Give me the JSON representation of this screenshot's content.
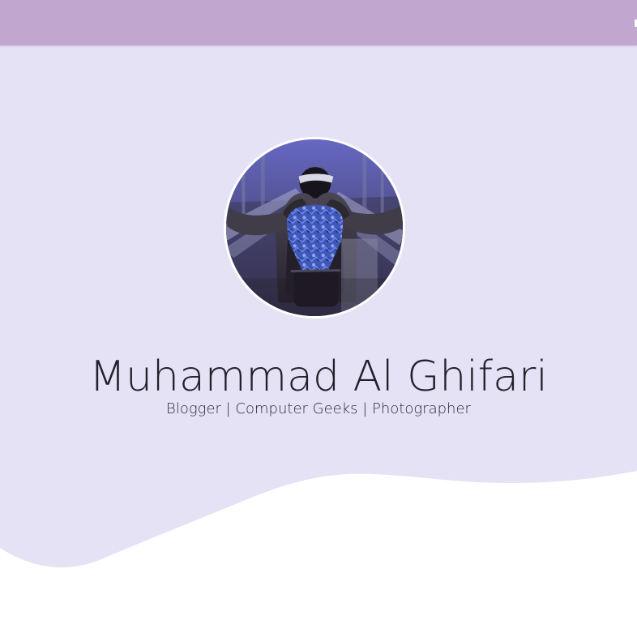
{
  "profile": {
    "name": "Muhammad Al Ghifari",
    "tagline": "Blogger | Computer Geeks | Photographer"
  },
  "theme": {
    "navbar_color": "#c1a7cf",
    "hero_background": "#e6e2f6",
    "page_background": "#ffffff",
    "text_color": "#24202b"
  },
  "icons": {
    "profile_image": "avatar-photo"
  }
}
